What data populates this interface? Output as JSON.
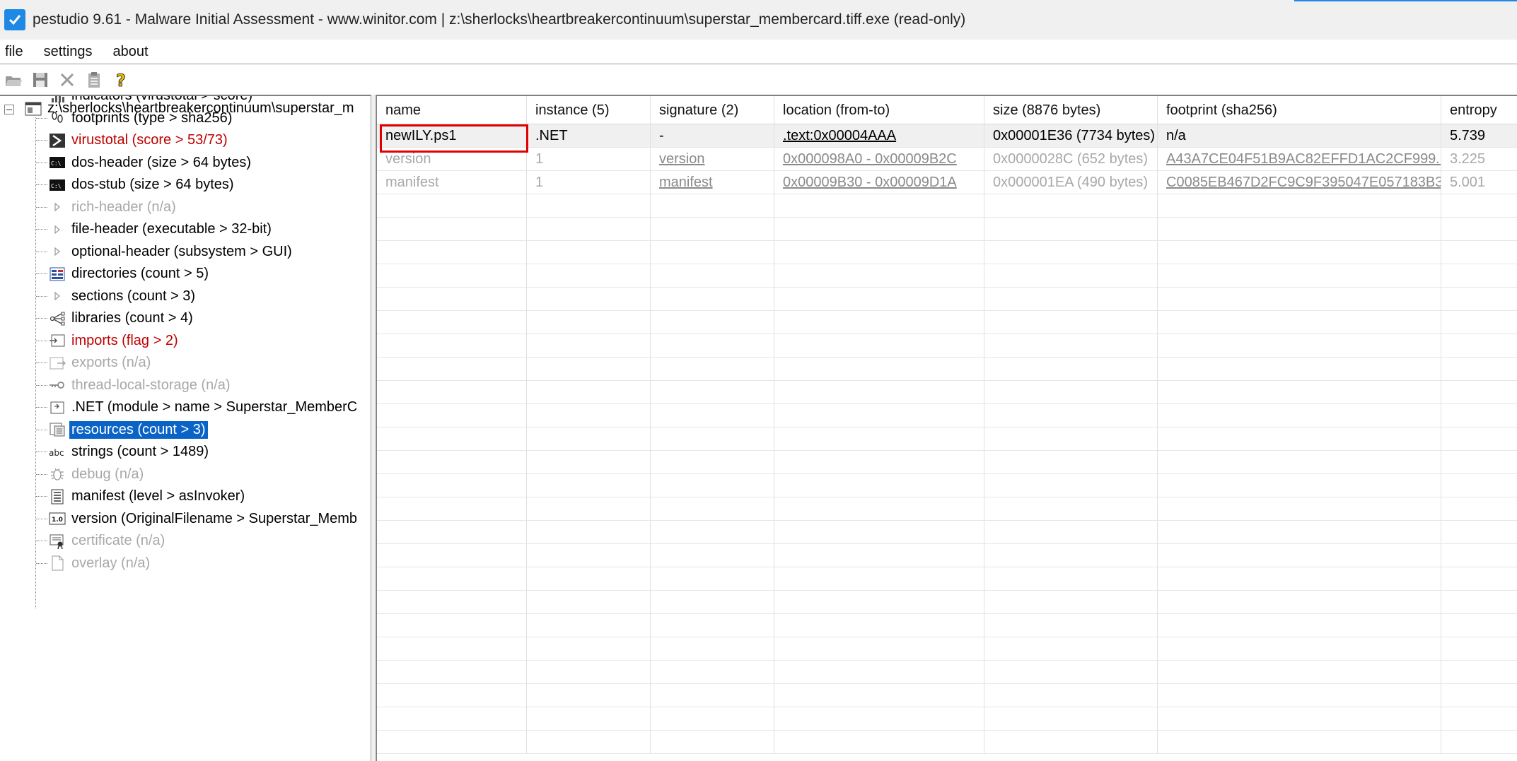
{
  "titlebar": {
    "title": "pestudio 9.61 - Malware Initial Assessment - www.winitor.com | z:\\sherlocks\\heartbreakercontinuum\\superstar_membercard.tiff.exe (read-only)"
  },
  "menu": [
    "file",
    "settings",
    "about"
  ],
  "toolbar": [
    {
      "name": "open-icon"
    },
    {
      "name": "save-icon"
    },
    {
      "name": "close-icon"
    },
    {
      "name": "clipboard-icon"
    },
    {
      "name": "help-icon"
    }
  ],
  "tree": {
    "root": "z:\\sherlocks\\heartbreakercontinuum\\superstar_m",
    "items": [
      {
        "label": "indicators (virustotal > score)",
        "style": "normal",
        "icon": "bars-icon"
      },
      {
        "label": "footprints (type > sha256)",
        "style": "normal",
        "icon": "footprints-icon"
      },
      {
        "label": "virustotal (score > 53/73)",
        "style": "red",
        "icon": "virustotal-icon"
      },
      {
        "label": "dos-header (size > 64 bytes)",
        "style": "normal",
        "icon": "console-icon"
      },
      {
        "label": "dos-stub (size > 64 bytes)",
        "style": "normal",
        "icon": "console-icon"
      },
      {
        "label": "rich-header (n/a)",
        "style": "gray",
        "icon": "expand-arrow-icon"
      },
      {
        "label": "file-header (executable > 32-bit)",
        "style": "normal",
        "icon": "expand-arrow-icon"
      },
      {
        "label": "optional-header (subsystem > GUI)",
        "style": "normal",
        "icon": "expand-arrow-icon"
      },
      {
        "label": "directories (count > 5)",
        "style": "normal",
        "icon": "directories-icon"
      },
      {
        "label": "sections (count > 3)",
        "style": "normal",
        "icon": "expand-arrow-icon"
      },
      {
        "label": "libraries (count > 4)",
        "style": "normal",
        "icon": "libraries-icon"
      },
      {
        "label": "imports (flag > 2)",
        "style": "red",
        "icon": "imports-icon"
      },
      {
        "label": "exports (n/a)",
        "style": "gray",
        "icon": "exports-icon"
      },
      {
        "label": "thread-local-storage (n/a)",
        "style": "gray",
        "icon": "key-icon"
      },
      {
        "label": ".NET (module > name > Superstar_MemberC",
        "style": "normal",
        "icon": "dotnet-icon"
      },
      {
        "label": "resources (count > 3)",
        "style": "selected",
        "icon": "resources-icon"
      },
      {
        "label": "strings (count > 1489)",
        "style": "normal",
        "icon": "abc-icon"
      },
      {
        "label": "debug (n/a)",
        "style": "gray",
        "icon": "bug-icon"
      },
      {
        "label": "manifest (level > asInvoker)",
        "style": "normal",
        "icon": "manifest-icon"
      },
      {
        "label": "version (OriginalFilename > Superstar_Memb",
        "style": "normal",
        "icon": "version-icon"
      },
      {
        "label": "certificate (n/a)",
        "style": "gray",
        "icon": "certificate-icon"
      },
      {
        "label": "overlay (n/a)",
        "style": "gray",
        "icon": "page-icon"
      }
    ],
    "version_badge": "1.0",
    "abc_text": "abc"
  },
  "grid": {
    "columns": [
      "name",
      "instance (5)",
      "signature (2)",
      "location (from-to)",
      "size (8876 bytes)",
      "footprint (sha256)",
      "entropy"
    ],
    "rows": [
      {
        "name": "newILY.ps1",
        "instance": ".NET",
        "signature": "-",
        "location": ".text:0x00004AAA",
        "size": "0x00001E36 (7734 bytes)",
        "footprint": "n/a",
        "entropy": "5.739",
        "gray": false,
        "sig_link": false,
        "fp_link": false
      },
      {
        "name": "version",
        "instance": "1",
        "signature": "version",
        "location": "0x000098A0 - 0x00009B2C",
        "size": "0x0000028C (652 bytes)",
        "footprint": "A43A7CE04F51B9AC82EFFD1AC2CF999...",
        "entropy": "3.225",
        "gray": true,
        "sig_link": true,
        "fp_link": true
      },
      {
        "name": "manifest",
        "instance": "1",
        "signature": "manifest",
        "location": "0x00009B30 - 0x00009D1A",
        "size": "0x000001EA (490 bytes)",
        "footprint": "C0085EB467D2FC9C9F395047E057183B3...",
        "entropy": "5.001",
        "gray": true,
        "sig_link": true,
        "fp_link": true
      }
    ]
  },
  "colors": {
    "accent": "#1e88e5",
    "selection": "#0a64c8",
    "flag_red": "#c00000",
    "highlight_red": "#e00000"
  }
}
